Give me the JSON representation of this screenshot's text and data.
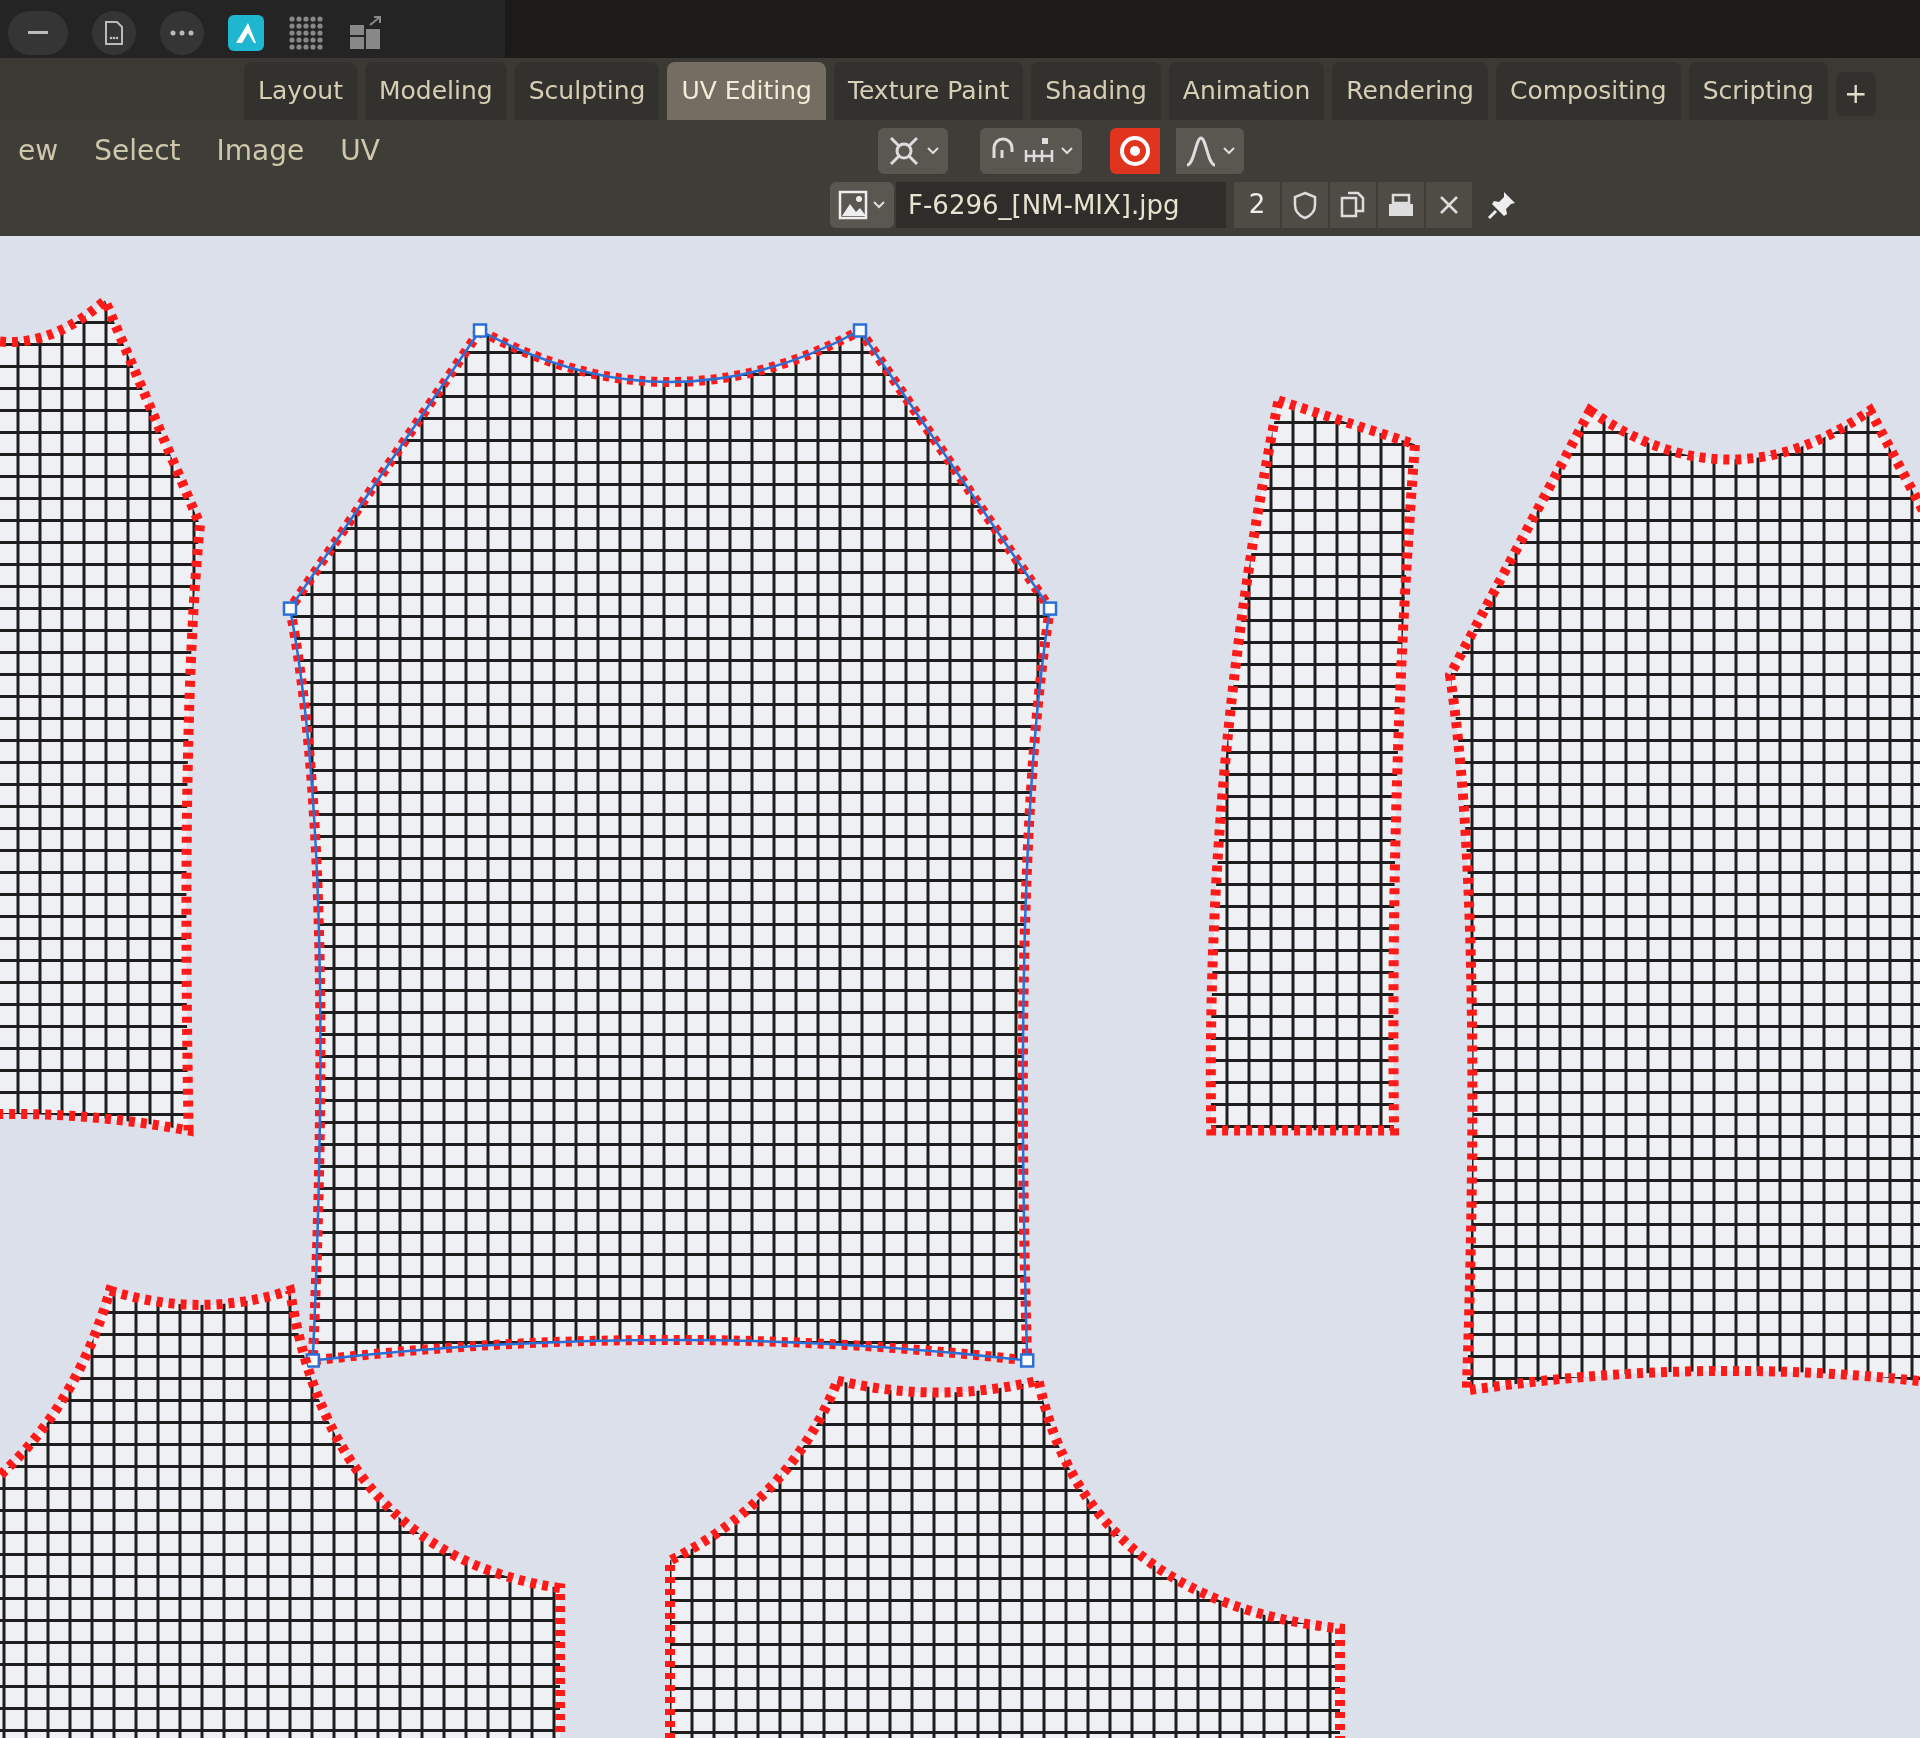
{
  "workspace_tabs": [
    {
      "label": "Layout",
      "selected": false
    },
    {
      "label": "Modeling",
      "selected": false
    },
    {
      "label": "Sculpting",
      "selected": false
    },
    {
      "label": "UV Editing",
      "selected": true
    },
    {
      "label": "Texture Paint",
      "selected": false
    },
    {
      "label": "Shading",
      "selected": false
    },
    {
      "label": "Animation",
      "selected": false
    },
    {
      "label": "Rendering",
      "selected": false
    },
    {
      "label": "Compositing",
      "selected": false
    },
    {
      "label": "Scripting",
      "selected": false
    }
  ],
  "add_tab": "+",
  "menu": [
    "ew",
    "Select",
    "Image",
    "UV"
  ],
  "toolbar": {
    "proportional_editing": {
      "on": true
    }
  },
  "image_header": {
    "name": "F-6296_[NM-MIX].jpg",
    "users": "2"
  },
  "uv_islands": [
    {
      "kind": "body",
      "selected": false
    },
    {
      "kind": "body",
      "selected": true
    },
    {
      "kind": "sleeve",
      "selected": false
    },
    {
      "kind": "body",
      "selected": false
    },
    {
      "kind": "yoke",
      "selected": false
    },
    {
      "kind": "yoke",
      "selected": false
    }
  ]
}
